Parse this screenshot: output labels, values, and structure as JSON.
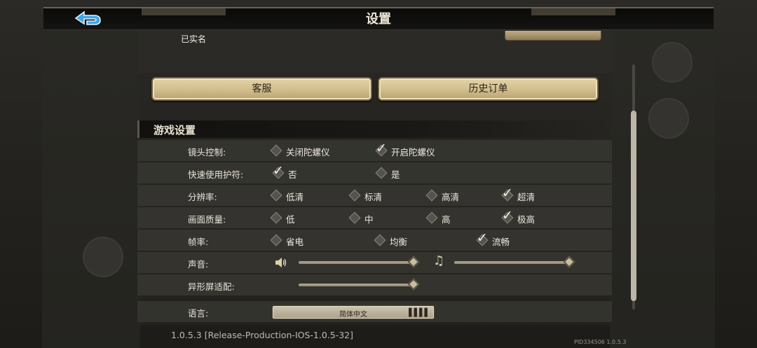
{
  "header": {
    "title": "设置"
  },
  "account": {
    "realname_label": "已实名"
  },
  "buttons": {
    "service": "客服",
    "history": "历史订单"
  },
  "section": {
    "title": "游戏设置"
  },
  "settings": {
    "camera": {
      "label": "镜头控制:",
      "options": [
        "关闭陀螺仪",
        "开启陀螺仪"
      ],
      "selected": 1
    },
    "quick_charm": {
      "label": "快速使用护符:",
      "options": [
        "否",
        "是"
      ],
      "selected": 0
    },
    "resolution": {
      "label": "分辨率:",
      "options": [
        "低清",
        "标清",
        "高清",
        "超清"
      ],
      "selected": 3
    },
    "quality": {
      "label": "画面质量:",
      "options": [
        "低",
        "中",
        "高",
        "极高"
      ],
      "selected": 3
    },
    "framerate": {
      "label": "帧率:",
      "options": [
        "省电",
        "均衡",
        "流畅"
      ],
      "selected": 2
    },
    "sound": {
      "label": "声音:",
      "sfx_level": 1.0,
      "music_level": 1.0
    },
    "notch": {
      "label": "异形屏适配:",
      "level": 1.0
    },
    "language": {
      "label": "语言:",
      "value": "简体中文"
    }
  },
  "footer": {
    "version": "1.0.5.3  [Release-Production-IOS-1.0.5-32]",
    "pid": "PID334506  1.0.5.3"
  },
  "icons": {
    "back": "back-arrow-icon",
    "speaker": "speaker-icon",
    "music": "music-note-icon",
    "lang": "bars-icon"
  }
}
